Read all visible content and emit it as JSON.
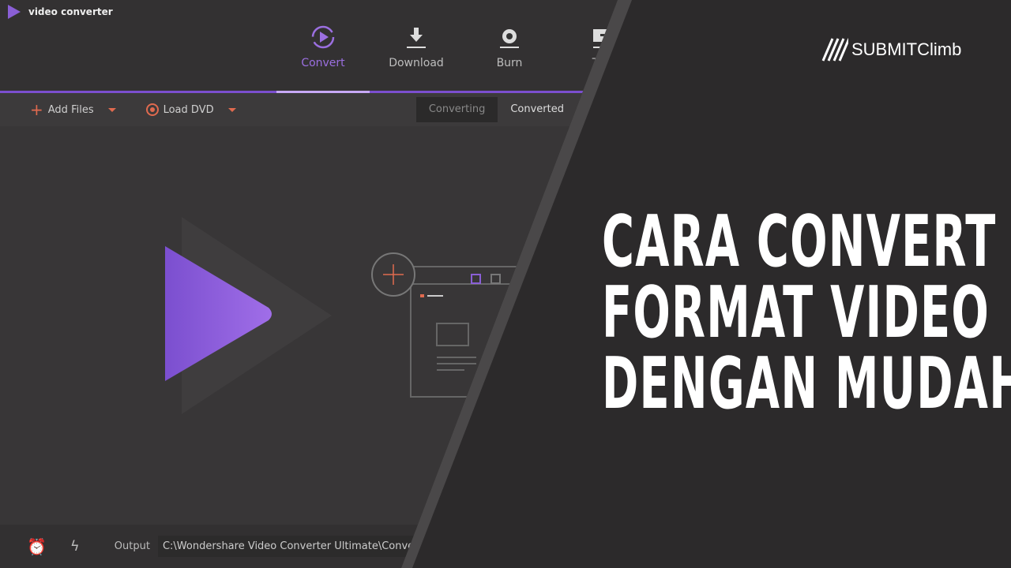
{
  "app": {
    "title": "video converter",
    "nav": [
      {
        "label": "Convert",
        "icon": "convert-icon",
        "active": true
      },
      {
        "label": "Download",
        "icon": "download-icon"
      },
      {
        "label": "Burn",
        "icon": "burn-icon"
      },
      {
        "label": "Trar",
        "icon": "transfer-icon"
      }
    ],
    "toolbar": {
      "add_files": "Add Files",
      "load_dvd": "Load DVD",
      "tabs": [
        "Converting",
        "Converted"
      ]
    },
    "bottom": {
      "output_label": "Output",
      "output_path": "C:\\Wondershare Video Converter Ultimate\\Convert"
    },
    "accent": "#8a5fd6"
  },
  "headline": [
    "CARA CONVERT",
    "FORMAT VIDEO",
    "DENGAN MUDAH"
  ],
  "brand": "SUBMITClimb"
}
